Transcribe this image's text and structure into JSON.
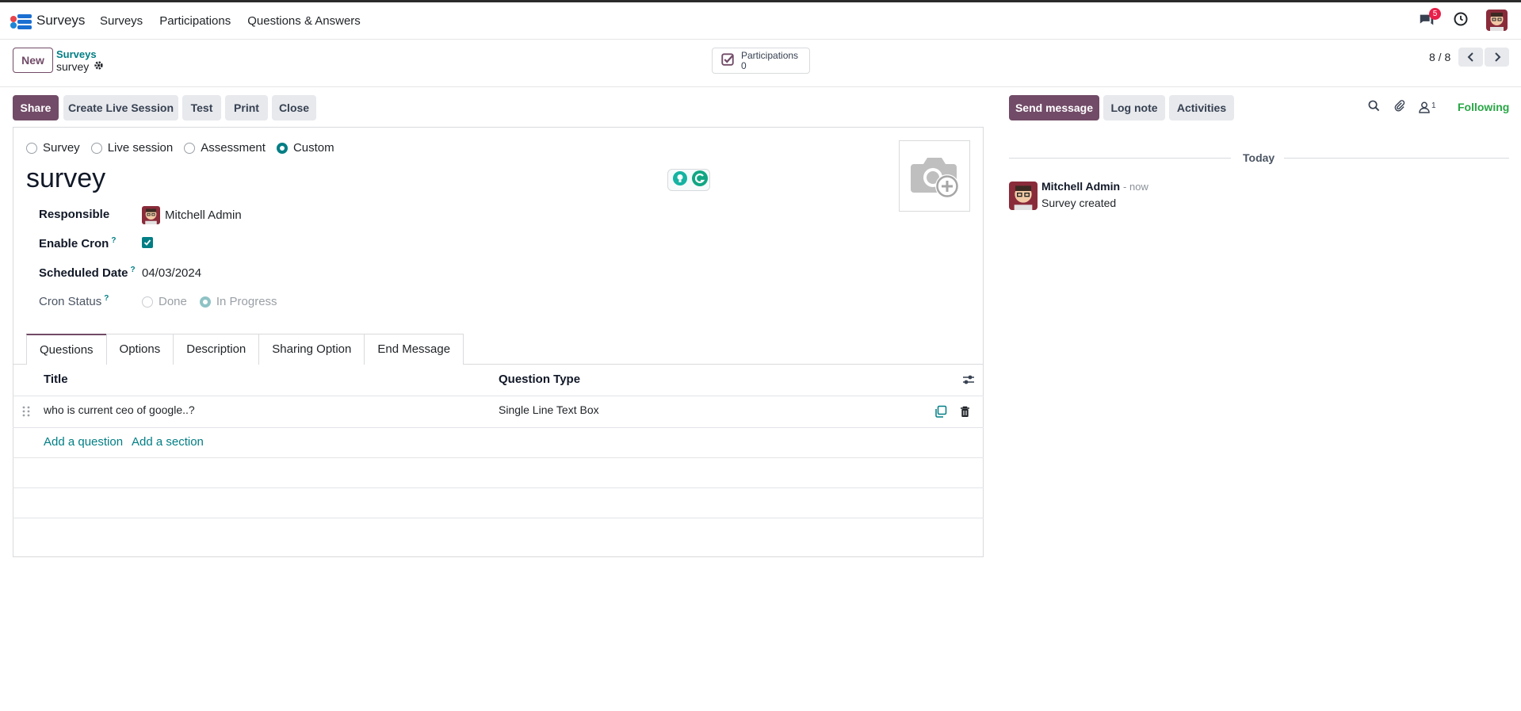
{
  "navbar": {
    "app_name": "Surveys",
    "menu": [
      "Surveys",
      "Participations",
      "Questions & Answers"
    ],
    "chat_badge": "5"
  },
  "control_panel": {
    "new_label": "New",
    "breadcrumb_parent": "Surveys",
    "breadcrumb_current": "survey",
    "stat_label": "Participations",
    "stat_value": "0",
    "pager": "8 / 8"
  },
  "actions": {
    "share": "Share",
    "live": "Create Live Session",
    "test": "Test",
    "print": "Print",
    "close": "Close"
  },
  "form": {
    "type_options": [
      "Survey",
      "Live session",
      "Assessment",
      "Custom"
    ],
    "selected_type": "Custom",
    "title": "survey",
    "fields": {
      "responsible_label": "Responsible",
      "responsible_value": "Mitchell Admin",
      "cron_label": "Enable Cron",
      "cron_enabled": true,
      "date_label": "Scheduled Date",
      "date_value": "04/03/2024",
      "status_label": "Cron Status",
      "status_options": [
        "Done",
        "In Progress"
      ],
      "status_selected": "In Progress"
    },
    "tooltip_marker": "?"
  },
  "tabs": [
    "Questions",
    "Options",
    "Description",
    "Sharing Option",
    "End Message"
  ],
  "questions": {
    "headers": {
      "title": "Title",
      "type": "Question Type"
    },
    "rows": [
      {
        "title": "who is current ceo of google..?",
        "type": "Single Line Text Box"
      }
    ],
    "add_question": "Add a question",
    "add_section": "Add a section"
  },
  "chatter": {
    "send_message": "Send message",
    "log_note": "Log note",
    "activities": "Activities",
    "followers_count": "1",
    "following": "Following",
    "date_separator": "Today",
    "message": {
      "author": "Mitchell Admin",
      "time": "- now",
      "body": "Survey created"
    }
  },
  "colors": {
    "primary": "#714b67",
    "accent": "#017e84",
    "following": "#28a745"
  }
}
